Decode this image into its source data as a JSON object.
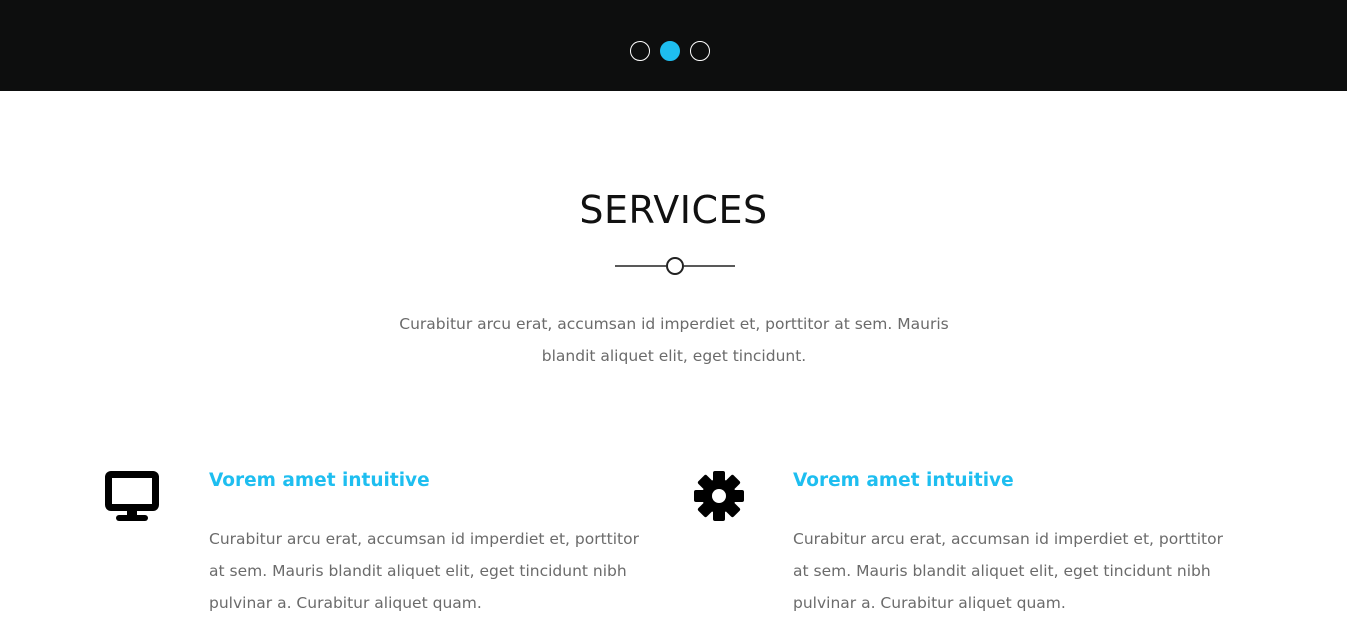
{
  "hero": {
    "slider_dots": [
      {
        "active": false
      },
      {
        "active": true
      },
      {
        "active": false
      }
    ]
  },
  "services": {
    "title": "SERVICES",
    "intro": "Curabitur arcu erat, accumsan id imperdiet et, porttitor at sem. Mauris blandit aliquet elit, eget tincidunt.",
    "items": [
      {
        "icon": "desktop-icon",
        "heading": "Vorem amet intuitive",
        "text": "Curabitur arcu erat, accumsan id imperdiet et, porttitor at sem. Mauris blandit aliquet elit, eget tincidunt nibh pulvinar a. Curabitur aliquet quam."
      },
      {
        "icon": "gear-icon",
        "heading": "Vorem amet intuitive",
        "text": "Curabitur arcu erat, accumsan id imperdiet et, porttitor at sem. Mauris blandit aliquet elit, eget tincidunt nibh pulvinar a. Curabitur aliquet quam."
      }
    ]
  },
  "colors": {
    "accent": "#1ebef0",
    "hero_bg": "#0d0e0e",
    "body_text": "#6b6b6b",
    "title_text": "#111111"
  }
}
